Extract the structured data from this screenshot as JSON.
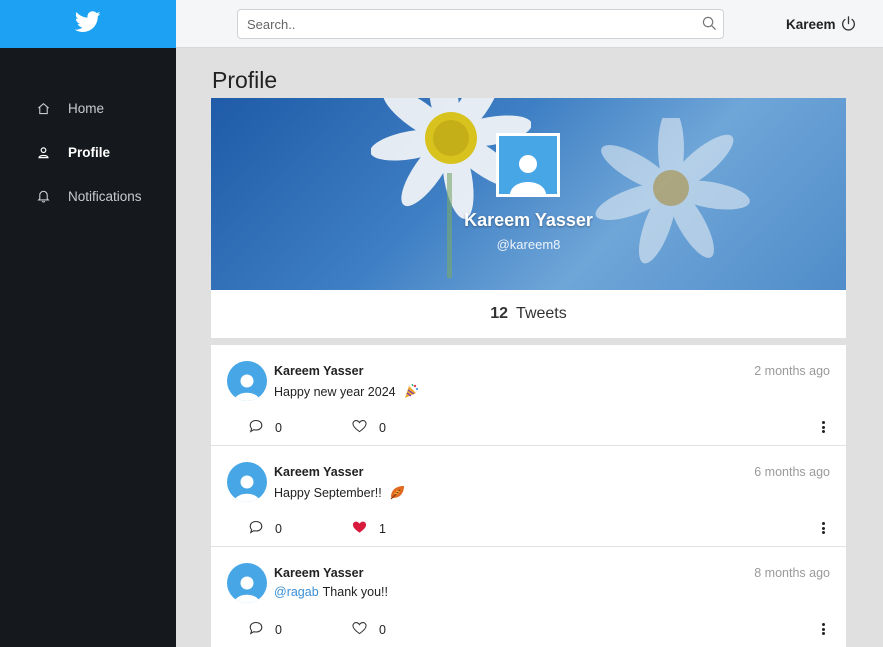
{
  "app": {
    "brand_color": "#1da1f2",
    "sidebar_bg": "#15181c",
    "logo_icon": "twitter-bird-icon"
  },
  "sidebar": {
    "items": [
      {
        "label": "Home",
        "icon": "home-icon",
        "active": false
      },
      {
        "label": "Profile",
        "icon": "user-icon",
        "active": true
      },
      {
        "label": "Notifications",
        "icon": "bell-icon",
        "active": false
      }
    ]
  },
  "header": {
    "search_placeholder": "Search..",
    "user_name": "Kareem",
    "logout_icon": "power-icon"
  },
  "page": {
    "title": "Profile"
  },
  "profile": {
    "name": "Kareem Yasser",
    "handle": "@kareem8",
    "tweet_count": "12",
    "tweet_count_label": "Tweets"
  },
  "tweets": [
    {
      "author": "Kareem Yasser",
      "time": "2 months ago",
      "mention": "",
      "text": "Happy new year 2024",
      "emoji": "party-popper",
      "replies": "0",
      "likes": "0",
      "liked": false
    },
    {
      "author": "Kareem Yasser",
      "time": "6 months ago",
      "mention": "",
      "text": "Happy September!!",
      "emoji": "autumn-leaf",
      "replies": "0",
      "likes": "1",
      "liked": true
    },
    {
      "author": "Kareem Yasser",
      "time": "8 months ago",
      "mention": "@ragab",
      "text": "Thank you!!",
      "emoji": "",
      "replies": "0",
      "likes": "0",
      "liked": false
    }
  ]
}
